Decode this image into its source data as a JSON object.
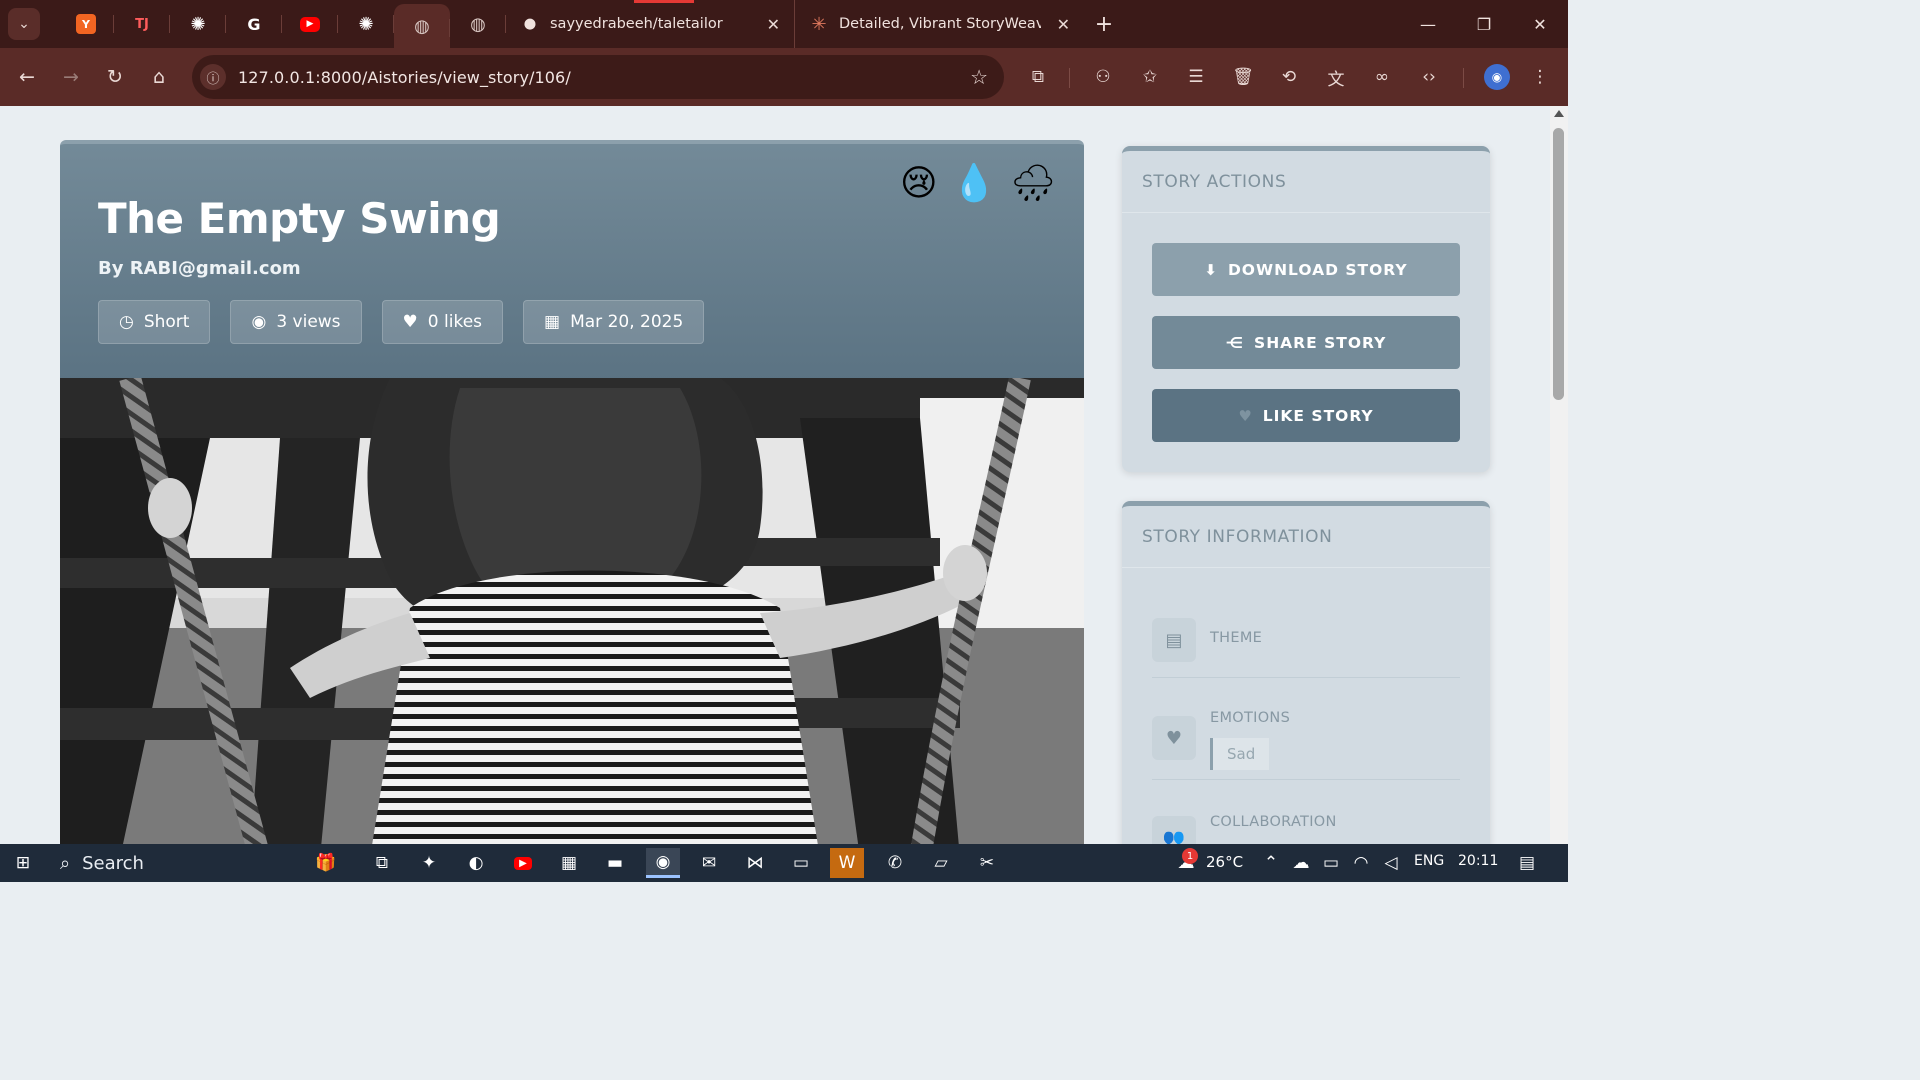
{
  "browser": {
    "tabs": [
      {
        "icon": "y-combinator-icon",
        "glyph": "Y",
        "color": "#f26522"
      },
      {
        "icon": "tj-icon",
        "glyph": "TJ",
        "color": "#c62828"
      },
      {
        "icon": "openai-icon",
        "glyph": "◎",
        "color": "transparent"
      },
      {
        "icon": "google-icon",
        "glyph": "G",
        "color": "transparent"
      },
      {
        "icon": "youtube-icon",
        "glyph": "▶",
        "color": "#ff0000"
      },
      {
        "icon": "openai-icon",
        "glyph": "◎",
        "color": "transparent"
      },
      {
        "icon": "globe-icon",
        "glyph": "◍",
        "color": "transparent"
      },
      {
        "icon": "globe-icon",
        "glyph": "◍",
        "color": "transparent"
      }
    ],
    "github_tab_title": "sayyedrabeeh/taletailor",
    "claude_tab_title": "Detailed, Vibrant StoryWeave R",
    "url": "127.0.0.1:8000/Aistories/view_story/106/"
  },
  "story": {
    "title": "The Empty Swing",
    "author": "By RABI@gmail.com",
    "length": "Short",
    "views": "3 views",
    "likes": "0 likes",
    "date": "Mar 20, 2025",
    "emojis": [
      "😢",
      "💧",
      "🌧"
    ]
  },
  "sidebar": {
    "actions_title": "STORY ACTIONS",
    "download_label": "DOWNLOAD STORY",
    "share_label": "SHARE STORY",
    "like_label": "LIKE STORY",
    "info_title": "STORY INFORMATION",
    "theme_label": "THEME",
    "emotions_label": "EMOTIONS",
    "emotion_tag": "Sad",
    "collab_label": "COLLABORATION"
  },
  "colors": {
    "download_bg": "#8ca0ac",
    "share_bg": "#738a98",
    "like_bg": "#5b7383"
  },
  "taskbar": {
    "search": "Search",
    "weather": "26°C",
    "lang": "ENG",
    "time": "20:11",
    "weather_badge": "1"
  }
}
